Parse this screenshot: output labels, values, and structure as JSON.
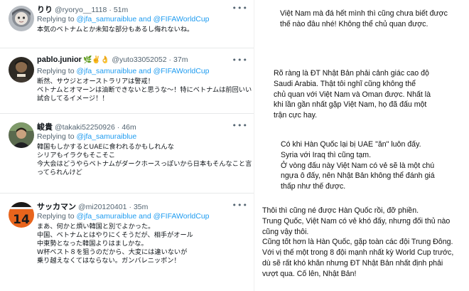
{
  "tweets": [
    {
      "name": "りり",
      "handle": "@ryoryo__1118",
      "dot": "·",
      "time": "51m",
      "reply_prefix": "Replying to",
      "reply_mentions": "@jfa_samuraiblue and @FIFAWorldCup",
      "lines": [
        "本気のベトナムとか未知な部分もあるし侮れないね。"
      ]
    },
    {
      "name": "pablo.junior",
      "emojis": "🌿✌️👌",
      "handle": "@yuto33052052",
      "dot": "·",
      "time": "37m",
      "reply_prefix": "Replying to",
      "reply_mentions": "@jfa_samuraiblue and @FIFAWorldCup",
      "lines": [
        "断然、サウジとオーストラリアは警戒！",
        "ベトナムとオマーンは油断できないと思うな〜！特にベトナムは前回いい",
        "試合してるイメージ！！"
      ]
    },
    {
      "name": "峻貴",
      "handle": "@takaki52250926",
      "dot": "·",
      "time": "46m",
      "reply_prefix": "Replying to",
      "reply_mentions": "@jfa_samuraiblue",
      "lines": [
        "韓国もしかするとUAEに食われるかもしれんな",
        "シリアもイラクもそこそこ",
        "今大会はどうやらベトナムがダークホースっぽいから日本もそんなこと言",
        "ってられんけど"
      ]
    },
    {
      "name": "サッカマン",
      "handle": "@mi20120401",
      "dot": "·",
      "time": "35m",
      "reply_prefix": "Replying to",
      "reply_mentions": "@jfa_samuraiblue and @FIFAWorldCup",
      "avatar_number": "14",
      "lines": [
        "まあ、何かと煩い韓国と別でよかった。",
        "中国、ベトナムとはやりにくそうだが、相手がオール",
        "中東勢となった韓国よりはましかな。",
        "W杯ベスト８を狙うのだから、大変には違いないが",
        "乗り越えなくてはならない。ガンバレニッポン！"
      ]
    }
  ],
  "vietnamese": [
    {
      "lines": [
        "Việt Nam mà đá hết mình thì cũng chưa biết được",
        "thế nào đâu nhé! Không thể chủ quan được."
      ]
    },
    {
      "lines": [
        "Rõ ràng là ĐT Nhật Bản phải cảnh giác cao độ",
        "Saudi Arabia. Thật tôi nghĩ cũng không thể",
        "chủ quan với Việt Nam và Oman được. Nhất là",
        "khi lần gần nhất gặp Việt Nam, họ đã đấu một",
        "trận cực hay."
      ]
    },
    {
      "lines": [
        "Có khi Hàn Quốc lại bị UAE \"ăn\" luôn đấy.",
        "Syria với Iraq thì cũng tạm.",
        "Ở vòng đấu này Việt Nam có vẻ sẽ là một chú",
        "ngựa ô đấy, nên Nhật Bản không thể đánh giá",
        "thấp như thế được."
      ]
    },
    {
      "lines": [
        "Thôi thì cũng né được Hàn Quốc rồi, đỡ phiền.",
        "Trung Quốc, Việt Nam có vẻ khó đấy, nhưng đối thủ nào",
        "cũng vậy thôi.",
        "Cũng tốt hơn là Hàn Quốc, gặp toàn các đội Trung Đông.",
        "Với vị thế một trong 8 đội mạnh nhất kỳ World Cup trước,",
        "dù sẽ rất khó khăn nhưng ĐT Nhật Bản nhất định phải",
        "vượt qua. Cố lên, Nhật Bản!"
      ]
    }
  ],
  "more_icon": "more-horizontal-icon",
  "colors": {
    "link": "#1d9bf0",
    "muted": "#536471",
    "text": "#0f1419",
    "border": "#e7e9ea"
  }
}
